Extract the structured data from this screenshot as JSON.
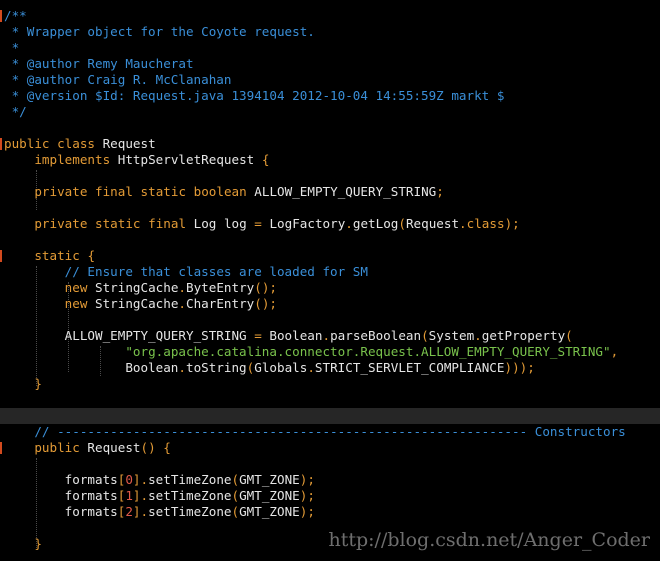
{
  "editor": {
    "lines": [
      {
        "tokens": [
          {
            "c": "tok-doc",
            "t": "/**"
          }
        ],
        "mark": true
      },
      {
        "tokens": [
          {
            "c": "tok-doc",
            "t": " * Wrapper object for the Coyote request."
          }
        ]
      },
      {
        "tokens": [
          {
            "c": "tok-doc",
            "t": " *"
          }
        ]
      },
      {
        "tokens": [
          {
            "c": "tok-doc",
            "t": " * @author Remy Maucherat"
          }
        ]
      },
      {
        "tokens": [
          {
            "c": "tok-doc",
            "t": " * @author Craig R. McClanahan"
          }
        ]
      },
      {
        "tokens": [
          {
            "c": "tok-doc",
            "t": " * @version $Id: Request.java 1394104 2012-10-04 14:55:59Z markt $"
          }
        ]
      },
      {
        "tokens": [
          {
            "c": "tok-doc",
            "t": " */"
          }
        ]
      },
      {
        "tokens": []
      },
      {
        "tokens": [
          {
            "c": "tok-kw",
            "t": "public"
          },
          {
            "c": "tok-plain",
            "t": " "
          },
          {
            "c": "tok-kw",
            "t": "class"
          },
          {
            "c": "tok-plain",
            "t": " Request"
          }
        ],
        "mark": true
      },
      {
        "tokens": [
          {
            "c": "tok-plain",
            "t": "    "
          },
          {
            "c": "tok-kw",
            "t": "implements"
          },
          {
            "c": "tok-plain",
            "t": " HttpServletRequest "
          },
          {
            "c": "tok-punct",
            "t": "{"
          }
        ]
      },
      {
        "tokens": []
      },
      {
        "tokens": [
          {
            "c": "tok-plain",
            "t": "    "
          },
          {
            "c": "tok-kw",
            "t": "private"
          },
          {
            "c": "tok-plain",
            "t": " "
          },
          {
            "c": "tok-kw",
            "t": "final"
          },
          {
            "c": "tok-plain",
            "t": " "
          },
          {
            "c": "tok-kw",
            "t": "static"
          },
          {
            "c": "tok-plain",
            "t": " "
          },
          {
            "c": "tok-kw",
            "t": "boolean"
          },
          {
            "c": "tok-plain",
            "t": " ALLOW_EMPTY_QUERY_STRING"
          },
          {
            "c": "tok-punct",
            "t": ";"
          }
        ]
      },
      {
        "tokens": []
      },
      {
        "tokens": [
          {
            "c": "tok-plain",
            "t": "    "
          },
          {
            "c": "tok-kw",
            "t": "private"
          },
          {
            "c": "tok-plain",
            "t": " "
          },
          {
            "c": "tok-kw",
            "t": "static"
          },
          {
            "c": "tok-plain",
            "t": " "
          },
          {
            "c": "tok-kw",
            "t": "final"
          },
          {
            "c": "tok-plain",
            "t": " Log log "
          },
          {
            "c": "tok-punct",
            "t": "="
          },
          {
            "c": "tok-plain",
            "t": " LogFactory"
          },
          {
            "c": "tok-punct",
            "t": "."
          },
          {
            "c": "tok-plain",
            "t": "getLog"
          },
          {
            "c": "tok-punct",
            "t": "("
          },
          {
            "c": "tok-plain",
            "t": "Request"
          },
          {
            "c": "tok-punct",
            "t": "."
          },
          {
            "c": "tok-kw",
            "t": "class"
          },
          {
            "c": "tok-punct",
            "t": ");"
          }
        ]
      },
      {
        "tokens": []
      },
      {
        "tokens": [
          {
            "c": "tok-plain",
            "t": "    "
          },
          {
            "c": "tok-kw",
            "t": "static"
          },
          {
            "c": "tok-plain",
            "t": " "
          },
          {
            "c": "tok-punct",
            "t": "{"
          }
        ],
        "mark": true
      },
      {
        "tokens": [
          {
            "c": "tok-plain",
            "t": "        "
          },
          {
            "c": "tok-comment",
            "t": "// Ensure that classes are loaded for SM"
          }
        ]
      },
      {
        "tokens": [
          {
            "c": "tok-plain",
            "t": "        "
          },
          {
            "c": "tok-kw",
            "t": "new"
          },
          {
            "c": "tok-plain",
            "t": " StringCache"
          },
          {
            "c": "tok-punct",
            "t": "."
          },
          {
            "c": "tok-plain",
            "t": "ByteEntry"
          },
          {
            "c": "tok-punct",
            "t": "();"
          }
        ]
      },
      {
        "tokens": [
          {
            "c": "tok-plain",
            "t": "        "
          },
          {
            "c": "tok-kw",
            "t": "new"
          },
          {
            "c": "tok-plain",
            "t": " StringCache"
          },
          {
            "c": "tok-punct",
            "t": "."
          },
          {
            "c": "tok-plain",
            "t": "CharEntry"
          },
          {
            "c": "tok-punct",
            "t": "();"
          }
        ]
      },
      {
        "tokens": []
      },
      {
        "tokens": [
          {
            "c": "tok-plain",
            "t": "        ALLOW_EMPTY_QUERY_STRING "
          },
          {
            "c": "tok-punct",
            "t": "="
          },
          {
            "c": "tok-plain",
            "t": " Boolean"
          },
          {
            "c": "tok-punct",
            "t": "."
          },
          {
            "c": "tok-plain",
            "t": "parseBoolean"
          },
          {
            "c": "tok-punct",
            "t": "("
          },
          {
            "c": "tok-plain",
            "t": "System"
          },
          {
            "c": "tok-punct",
            "t": "."
          },
          {
            "c": "tok-plain",
            "t": "getProperty"
          },
          {
            "c": "tok-punct",
            "t": "("
          }
        ]
      },
      {
        "tokens": [
          {
            "c": "tok-plain",
            "t": "                "
          },
          {
            "c": "tok-str",
            "t": "\"org.apache.catalina.connector.Request.ALLOW_EMPTY_QUERY_STRING\""
          },
          {
            "c": "tok-punct",
            "t": ","
          }
        ]
      },
      {
        "tokens": [
          {
            "c": "tok-plain",
            "t": "                Boolean"
          },
          {
            "c": "tok-punct",
            "t": "."
          },
          {
            "c": "tok-plain",
            "t": "toString"
          },
          {
            "c": "tok-punct",
            "t": "("
          },
          {
            "c": "tok-plain",
            "t": "Globals"
          },
          {
            "c": "tok-punct",
            "t": "."
          },
          {
            "c": "tok-plain",
            "t": "STRICT_SERVLET_COMPLIANCE"
          },
          {
            "c": "tok-punct",
            "t": ")));"
          }
        ]
      },
      {
        "tokens": [
          {
            "c": "tok-plain",
            "t": "    "
          },
          {
            "c": "tok-punct",
            "t": "}"
          }
        ]
      },
      {
        "tokens": []
      },
      {
        "tokens": [],
        "highlight": true
      },
      {
        "tokens": [
          {
            "c": "tok-plain",
            "t": "    "
          },
          {
            "c": "tok-comment",
            "t": "// -------------------------------------------------------------- Constructors"
          }
        ]
      },
      {
        "tokens": [
          {
            "c": "tok-plain",
            "t": "    "
          },
          {
            "c": "tok-kw",
            "t": "public"
          },
          {
            "c": "tok-plain",
            "t": " Request"
          },
          {
            "c": "tok-punct",
            "t": "()"
          },
          {
            "c": "tok-plain",
            "t": " "
          },
          {
            "c": "tok-punct",
            "t": "{"
          }
        ],
        "mark": true
      },
      {
        "tokens": []
      },
      {
        "tokens": [
          {
            "c": "tok-plain",
            "t": "        formats"
          },
          {
            "c": "tok-punct",
            "t": "["
          },
          {
            "c": "tok-num",
            "t": "0"
          },
          {
            "c": "tok-punct",
            "t": "]."
          },
          {
            "c": "tok-plain",
            "t": "setTimeZone"
          },
          {
            "c": "tok-punct",
            "t": "("
          },
          {
            "c": "tok-plain",
            "t": "GMT_ZONE"
          },
          {
            "c": "tok-punct",
            "t": ");"
          }
        ]
      },
      {
        "tokens": [
          {
            "c": "tok-plain",
            "t": "        formats"
          },
          {
            "c": "tok-punct",
            "t": "["
          },
          {
            "c": "tok-num",
            "t": "1"
          },
          {
            "c": "tok-punct",
            "t": "]."
          },
          {
            "c": "tok-plain",
            "t": "setTimeZone"
          },
          {
            "c": "tok-punct",
            "t": "("
          },
          {
            "c": "tok-plain",
            "t": "GMT_ZONE"
          },
          {
            "c": "tok-punct",
            "t": ");"
          }
        ]
      },
      {
        "tokens": [
          {
            "c": "tok-plain",
            "t": "        formats"
          },
          {
            "c": "tok-punct",
            "t": "["
          },
          {
            "c": "tok-num",
            "t": "2"
          },
          {
            "c": "tok-punct",
            "t": "]."
          },
          {
            "c": "tok-plain",
            "t": "setTimeZone"
          },
          {
            "c": "tok-punct",
            "t": "("
          },
          {
            "c": "tok-plain",
            "t": "GMT_ZONE"
          },
          {
            "c": "tok-punct",
            "t": ");"
          }
        ]
      },
      {
        "tokens": []
      },
      {
        "tokens": [
          {
            "c": "tok-plain",
            "t": "    "
          },
          {
            "c": "tok-punct",
            "t": "}"
          }
        ]
      }
    ]
  },
  "watermark": "http://blog.csdn.net/Anger_Coder"
}
